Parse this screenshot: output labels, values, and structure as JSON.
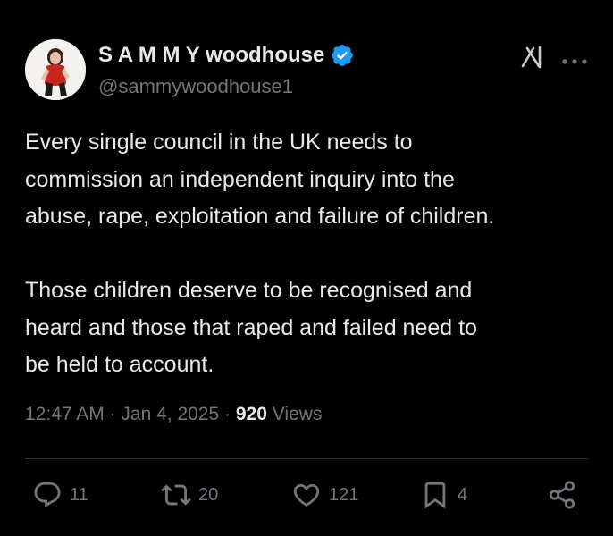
{
  "author": {
    "display_name": "S A M M Y woodhouse",
    "handle": "@sammywoodhouse1",
    "verified": true,
    "verified_color": "#1d9bf0"
  },
  "header_icons": [
    "grok-icon",
    "more-icon"
  ],
  "tweet": {
    "text": "Every single council in the UK needs to\ncommission an independent inquiry into the\nabuse, rape, exploitation and failure of children.\n\nThose children deserve to be recognised and\nheard and those that raped and failed need to\nbe held to account.",
    "time": "12:47 AM",
    "date": "Jan 4, 2025",
    "views_count": "920",
    "views_label": "Views"
  },
  "actions": {
    "replies": "11",
    "reposts": "20",
    "likes": "121",
    "bookmarks": "4"
  },
  "colors": {
    "background": "#000000",
    "text": "#e7e9ea",
    "secondary": "#71767b",
    "divider": "#2f3336"
  }
}
